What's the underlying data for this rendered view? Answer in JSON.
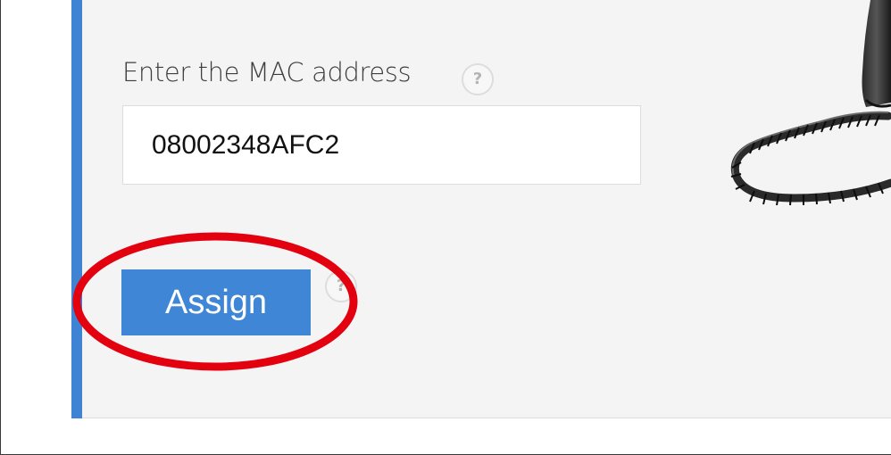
{
  "form": {
    "mac_label": "Enter the MAC address",
    "mac_value": "08002348AFC2",
    "help_glyph": "?",
    "assign_label": "Assign"
  },
  "icons": {
    "help": "help-icon",
    "phone": "phone-image",
    "highlight": "red-ellipse-annotation"
  },
  "colors": {
    "accent": "#3f84d4",
    "button": "#3f87d6",
    "panel": "#f4f4f4",
    "annotation": "#e3000f"
  }
}
